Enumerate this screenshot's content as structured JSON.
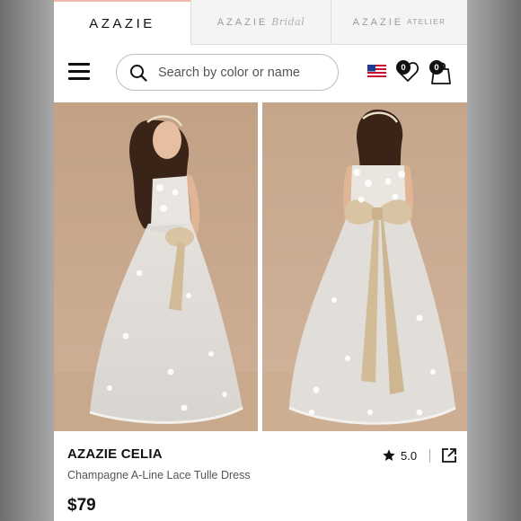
{
  "brand_tabs": [
    {
      "main": "AZAZIE",
      "accent": ""
    },
    {
      "main": "AZAZIE",
      "accent": "Bridal"
    },
    {
      "main": "AZAZIE",
      "accent": "ATELIER"
    }
  ],
  "search": {
    "placeholder": "Search by color or name"
  },
  "header": {
    "wishlist_count": "0",
    "cart_count": "0"
  },
  "product": {
    "name": "AZAZIE CELIA",
    "description": "Champagne A-Line Lace Tulle Dress",
    "price": "$79",
    "rating": "5.0"
  },
  "icons": [
    "menu-icon",
    "search-icon",
    "us-flag-icon",
    "heart-icon",
    "bag-icon",
    "star-icon",
    "share-icon"
  ],
  "colors": {
    "accent_tab": "#f0b8a8",
    "photo_background": "#c9a88c",
    "dress": "#e3e0dc",
    "bow": "#d8c4a2"
  }
}
